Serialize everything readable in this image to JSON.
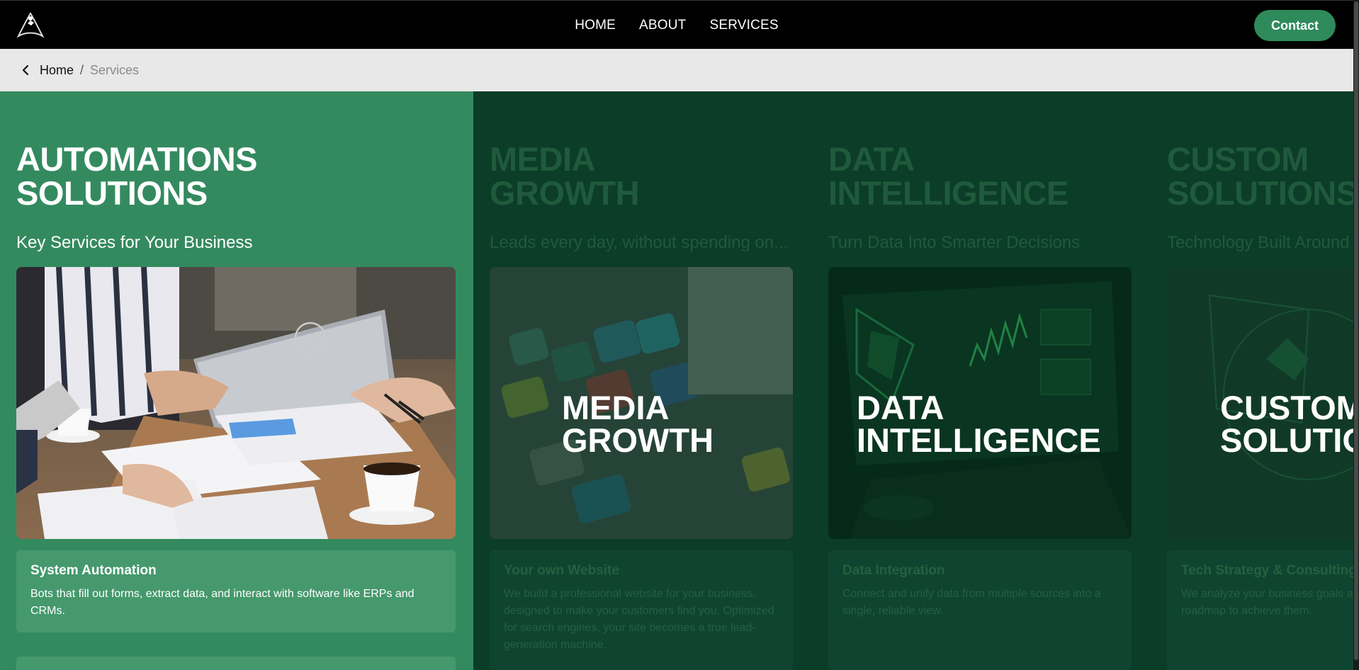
{
  "nav": {
    "links": [
      "HOME",
      "ABOUT",
      "SERVICES"
    ],
    "contact_label": "Contact"
  },
  "breadcrumb": {
    "home": "Home",
    "separator": "/",
    "current": "Services"
  },
  "services": [
    {
      "title_line1": "AUTOMATIONS",
      "title_line2": "SOLUTIONS",
      "subtitle": "Key Services for Your Business",
      "card_title": "System Automation",
      "card_desc": "Bots that fill out forms, extract data, and interact with software like ERPs and CRMs."
    },
    {
      "title_line1": "MEDIA",
      "title_line2": "GROWTH",
      "subtitle": "Leads every day, without spending on...",
      "overlay_line1": "MEDIA",
      "overlay_line2": "GROWTH",
      "card_title": "Your own Website",
      "card_desc": "We build a professional website for your business, designed to make your customers find you. Optimized for search engines, your site becomes a true lead-generation machine."
    },
    {
      "title_line1": "DATA",
      "title_line2": "INTELLIGENCE",
      "subtitle": "Turn Data Into Smarter Decisions",
      "overlay_line1": "DATA",
      "overlay_line2": "INTELLIGENCE",
      "card_title": "Data Integration",
      "card_desc": "Connect and unify data from multiple sources into a single, reliable view."
    },
    {
      "title_line1": "CUSTOM",
      "title_line2": "SOLUTIONS",
      "subtitle": "Technology Built Around",
      "overlay_line1": "CUSTOM",
      "overlay_line2": "SOLUTIONS",
      "card_title": "Tech Strategy & Consulting",
      "card_desc": "We analyze your business goals and technology roadmap to achieve them."
    }
  ],
  "colors": {
    "active_panel": "#348a5f",
    "dim_panel": "#0c3d28",
    "accent": "#2f8a5b"
  }
}
